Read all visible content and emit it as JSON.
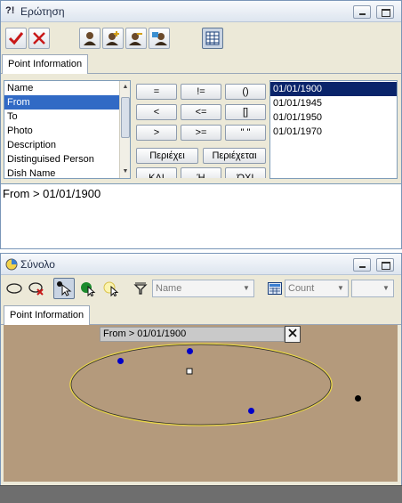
{
  "query_window": {
    "title_icon": "?!",
    "title": "Ερώτηση",
    "toolbar_icons": [
      "check-icon",
      "cross-icon",
      "person-icon",
      "person-add-icon",
      "person-remove-icon",
      "person-edit-icon",
      "table-icon"
    ],
    "tab_label": "Point Information",
    "fields": [
      "Name",
      "From",
      "To",
      "Photo",
      "Description",
      "Distinguised Person",
      "Dish Name"
    ],
    "selected_field": "From",
    "operators": [
      "=",
      "!=",
      "()",
      "<",
      "<=",
      "[]",
      ">",
      ">=",
      "\" \""
    ],
    "contains_label": "Περιέχει",
    "contained_label": "Περιέχεται",
    "and_label": "ΚΑΙ",
    "or_label": "Ή",
    "not_label": "ΌΧΙ",
    "values": [
      "01/01/1900",
      "01/01/1945",
      "01/01/1950",
      "01/01/1970"
    ],
    "selected_value": "01/01/1900",
    "expression": "From > 01/01/1900"
  },
  "set_window": {
    "title": "Σύνολο",
    "tab_label": "Point Information",
    "name_combo": "Name",
    "count_combo": "Count",
    "filter_label": "From > 01/01/1900",
    "colors": {
      "canvas": "#b49a7c",
      "points": "#0000c8",
      "outside_point": "#000000",
      "ellipse_stroke": "#e8d44a"
    }
  }
}
